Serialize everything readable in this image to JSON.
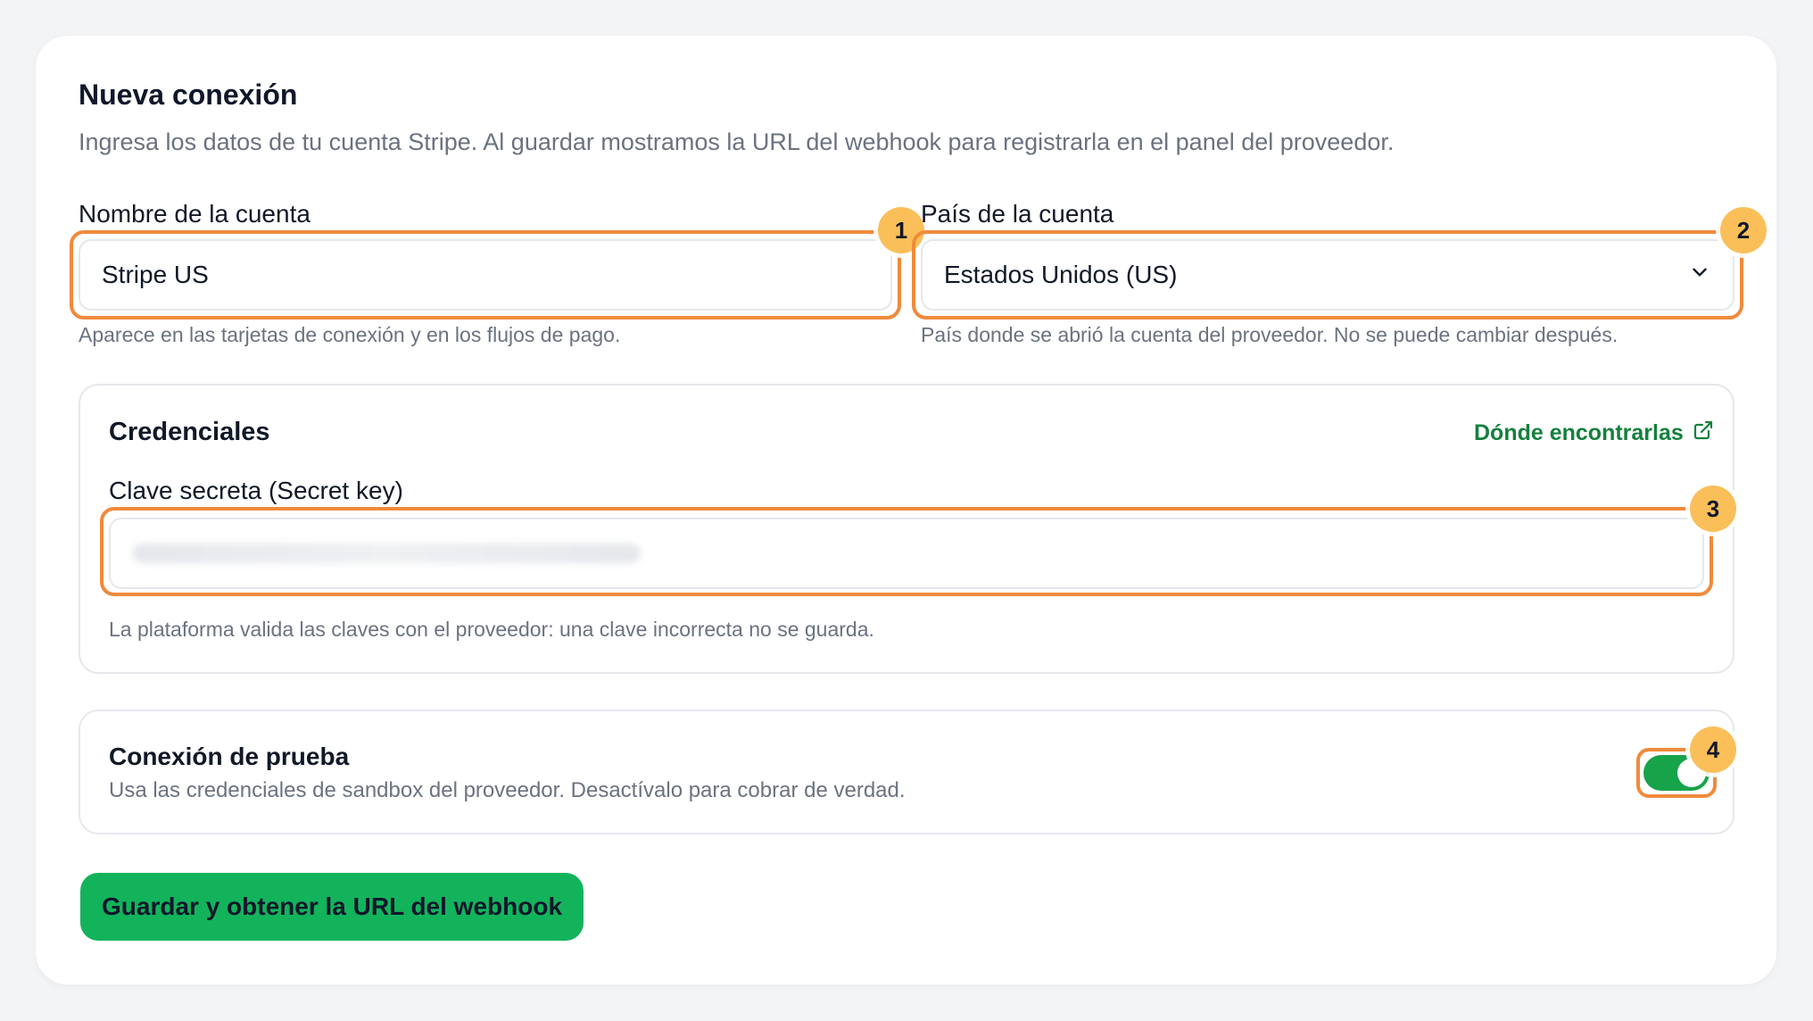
{
  "form": {
    "title": "Nueva conexión",
    "subtitle": "Ingresa los datos de tu cuenta Stripe. Al guardar mostramos la URL del webhook para registrarla en el panel del proveedor.",
    "account_name": {
      "label": "Nombre de la cuenta",
      "value": "Stripe US",
      "help": "Aparece en las tarjetas de conexión y en los flujos de pago."
    },
    "account_country": {
      "label": "País de la cuenta",
      "value": "Estados Unidos (US)",
      "help": "País donde se abrió la cuenta del proveedor. No se puede cambiar después."
    },
    "credentials": {
      "title": "Credenciales",
      "link_label": "Dónde encontrarlas",
      "secret_label": "Clave secreta (Secret key)",
      "secret_help": "La plataforma valida las claves con el proveedor: una clave incorrecta no se guarda."
    },
    "test_mode": {
      "title": "Conexión de prueba",
      "description": "Usa las credenciales de sandbox del proveedor. Desactívalo para cobrar de verdad.",
      "enabled": true
    },
    "submit_label": "Guardar y obtener la URL del webhook"
  },
  "callouts": [
    "1",
    "2",
    "3",
    "4"
  ],
  "colors": {
    "accent_green": "#13b35c",
    "link_green": "#15803d",
    "highlight_orange": "#f08a3c",
    "badge_yellow": "#fbbf5a"
  }
}
